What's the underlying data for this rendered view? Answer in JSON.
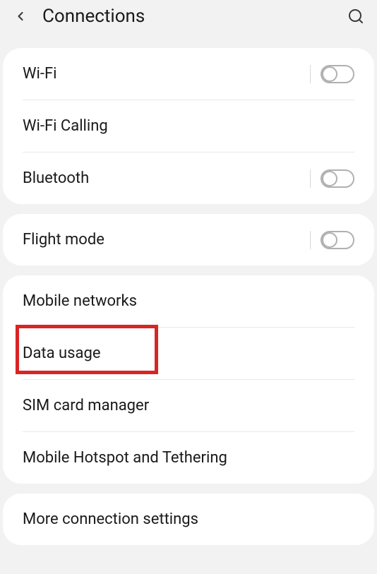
{
  "header": {
    "title": "Connections"
  },
  "group1": {
    "items": [
      {
        "label": "Wi-Fi",
        "id": "wifi",
        "hasToggle": true
      },
      {
        "label": "Wi-Fi Calling",
        "id": "wifi-calling",
        "hasToggle": false
      },
      {
        "label": "Bluetooth",
        "id": "bluetooth",
        "hasToggle": true
      }
    ]
  },
  "group2": {
    "items": [
      {
        "label": "Flight mode",
        "id": "flight-mode",
        "hasToggle": true
      }
    ]
  },
  "group3": {
    "items": [
      {
        "label": "Mobile networks",
        "id": "mobile-networks",
        "hasToggle": false
      },
      {
        "label": "Data usage",
        "id": "data-usage",
        "hasToggle": false,
        "highlighted": true
      },
      {
        "label": "SIM card manager",
        "id": "sim-card-manager",
        "hasToggle": false
      },
      {
        "label": "Mobile Hotspot and Tethering",
        "id": "mobile-hotspot",
        "hasToggle": false
      }
    ]
  },
  "group4": {
    "items": [
      {
        "label": "More connection settings",
        "id": "more-connection",
        "hasToggle": false
      }
    ]
  }
}
